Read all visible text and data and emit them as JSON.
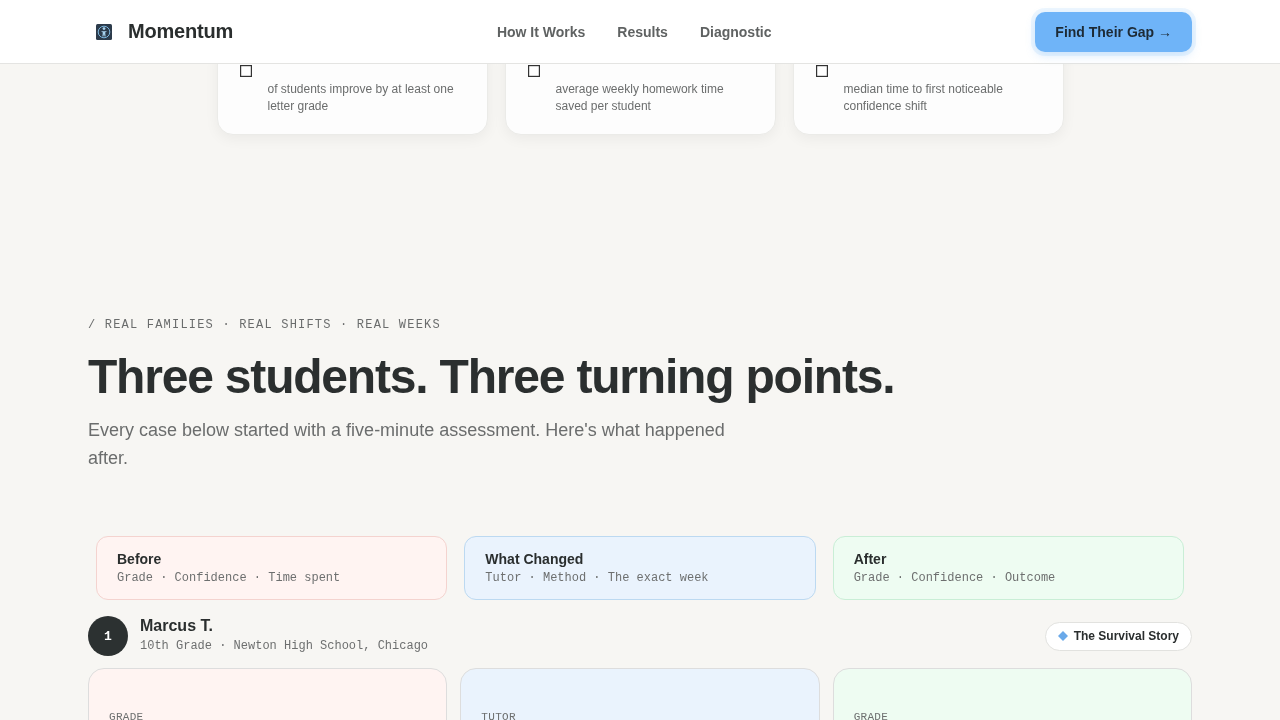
{
  "header": {
    "brand": "Momentum",
    "nav": [
      {
        "label": "How It Works"
      },
      {
        "label": "Results"
      },
      {
        "label": "Diagnostic"
      }
    ],
    "cta": "Find Their Gap →"
  },
  "stats": [
    {
      "description": "of students improve by at least one letter grade"
    },
    {
      "description": "average weekly homework time saved per student"
    },
    {
      "description": "median time to first noticeable confidence shift"
    }
  ],
  "section": {
    "eyebrow": "/ REAL FAMILIES · REAL SHIFTS · REAL WEEKS",
    "title": "Three students. Three turning points.",
    "subtitle": "Every case below started with a five-minute assessment. Here's what happened after."
  },
  "columns": [
    {
      "kind": "before",
      "title": "Before",
      "subtitle": "Grade · Confidence · Time spent"
    },
    {
      "kind": "changed",
      "title": "What Changed",
      "subtitle": "Tutor · Method · The exact week"
    },
    {
      "kind": "after",
      "title": "After",
      "subtitle": "Grade · Confidence · Outcome"
    }
  ],
  "cases": [
    {
      "number": "1",
      "name": "Marcus T.",
      "meta": "10th Grade · Newton High School, Chicago",
      "badge": "The Survival Story",
      "panels": [
        {
          "kind": "before",
          "label": "GRADE"
        },
        {
          "kind": "changed",
          "label": "TUTOR"
        },
        {
          "kind": "after",
          "label": "GRADE"
        }
      ]
    }
  ]
}
